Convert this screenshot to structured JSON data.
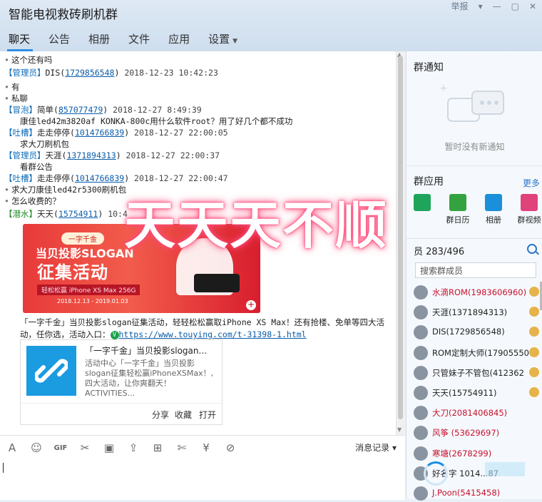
{
  "window": {
    "title": "智能电视救砖刷机群",
    "report": "举报",
    "controls": [
      "▾",
      "—",
      "▢",
      "✕"
    ]
  },
  "tabs": [
    {
      "label": "聊天"
    },
    {
      "label": "公告"
    },
    {
      "label": "相册"
    },
    {
      "label": "文件"
    },
    {
      "label": "应用"
    },
    {
      "label": "设置"
    }
  ],
  "chat": {
    "lines": [
      {
        "kind": "text",
        "bullet": "•",
        "text": "这个还有吗"
      },
      {
        "kind": "header",
        "tag": "【管理员】",
        "name": "DIS",
        "uid": "1729856548",
        "time": "2018-12-23 10:42:23"
      },
      {
        "kind": "text",
        "bullet": "•",
        "text": "有"
      },
      {
        "kind": "text",
        "bullet": "•",
        "text": "私聊"
      },
      {
        "kind": "header",
        "tag": "【冒泡】",
        "name": "简单",
        "uid": "857077479",
        "time": "2018-12-27 8:49:39"
      },
      {
        "kind": "plain",
        "text": "康佳led42m3820af KONKA-800c用什么软件root？用了好几个都不成功"
      },
      {
        "kind": "header",
        "tag": "【吐槽】",
        "name": "走走停停",
        "uid": "1014766839",
        "time": "2018-12-27 22:00:05"
      },
      {
        "kind": "plain",
        "text": "求大刀刷机包"
      },
      {
        "kind": "header",
        "tag": "【管理员】",
        "name": "天涯",
        "uid": "1371894313",
        "time": "2018-12-27 22:00:37"
      },
      {
        "kind": "plain",
        "text": "看群公告"
      },
      {
        "kind": "header",
        "tag": "【吐槽】",
        "name": "走走停停",
        "uid": "1014766839",
        "time": "2018-12-27 22:00:47"
      },
      {
        "kind": "text",
        "bullet": "•",
        "text": "求大刀康佳led42r5300刷机包"
      },
      {
        "kind": "text",
        "bullet": "•",
        "text": "怎么收费的？"
      },
      {
        "kind": "header",
        "tag": "【潜水】",
        "name": "天天",
        "uid": "15754911",
        "time": "10:4"
      }
    ],
    "banner": {
      "pill": "一字千金",
      "line1": "当贝投影SLOGAN",
      "line2": "征集活动",
      "sub": "轻松松赢 iPhone XS Max 256G",
      "date": "2018.12.13 - 2019.01.03"
    },
    "message": {
      "text1": "「一字千金」当贝投影slogan征集活动，轻轻松松赢取iPhone XS Max！还有抢楼、免单等四大活动，任你选，活动入口：",
      "link": "https://www.touying.com/t-31398-1.html"
    },
    "card": {
      "title": "「一字千金」当贝投影slogan...",
      "desc": "活动中心「一字千金」当贝投影slogan征集轻松赢iPhoneXSMax！,四大活动，让你爽翻天！ACTIVITIES...",
      "share": "分享",
      "favorite": "收藏",
      "open": "打开"
    },
    "overlay_text": "天天天不顺"
  },
  "input": {
    "message_log": "消息记录"
  },
  "right": {
    "notice_title": "群通知",
    "notice_empty": "暂时没有新通知",
    "apps_title": "群应用",
    "more": "更多",
    "apps": [
      {
        "label": "",
        "color": "#1fa55b"
      },
      {
        "label": "群日历",
        "color": "#33a33f"
      },
      {
        "label": "相册",
        "color": "#1b8fd9"
      },
      {
        "label": "群视频",
        "color": "#e0427a"
      }
    ],
    "members_title": "员 283/496",
    "search_placeholder": "搜索群成员",
    "members": [
      {
        "name": "水滴ROM(1983606960)",
        "color": "#c8102e"
      },
      {
        "name": "天涯(1371894313)",
        "color": "#222222"
      },
      {
        "name": "DIS(1729856548)",
        "color": "#222222"
      },
      {
        "name": "ROM定制大师(17905550",
        "color": "#222222"
      },
      {
        "name": "只管妹子不管包(412362",
        "color": "#222222"
      },
      {
        "name": "天天(15754911)",
        "color": "#222222"
      },
      {
        "name": "大刀(2081406845)",
        "color": "#c8102e"
      },
      {
        "name": "风筝  (53629697)",
        "color": "#c8102e"
      },
      {
        "name": "寒塘(2678299)",
        "color": "#c8102e"
      },
      {
        "name": "好名字  1014...87",
        "color": "#222222"
      },
      {
        "name": "J.Poon(5415458)",
        "color": "#c8102e"
      }
    ]
  }
}
